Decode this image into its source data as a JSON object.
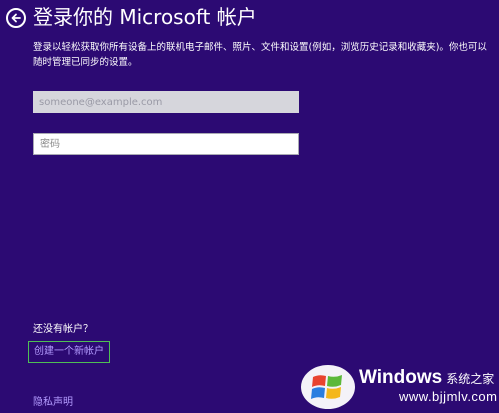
{
  "header": {
    "title": "登录你的 Microsoft 帐户",
    "back_icon": "back-arrow-circle-icon"
  },
  "description": "登录以轻松获取你所有设备上的联机电子邮件、照片、文件和设置(例如，浏览历史记录和收藏夹)。你也可以随时管理已同步的设置。",
  "form": {
    "email_placeholder": "someone@example.com",
    "password_placeholder": "密码"
  },
  "signup": {
    "prompt": "还没有帐户？",
    "create_link": "创建一个新帐户"
  },
  "footer": {
    "privacy_link": "隐私声明"
  },
  "watermark": {
    "brand": "Windows",
    "site_name": "系统之家",
    "url": "www.bjjmlv.com"
  },
  "colors": {
    "background": "#2c0a73",
    "link": "#b49cff",
    "highlight_border": "#4fbf55"
  }
}
